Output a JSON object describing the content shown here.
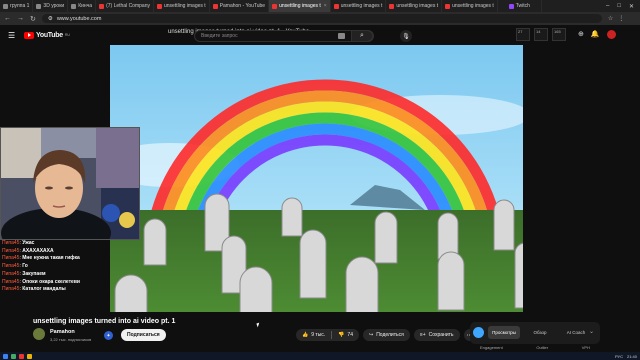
{
  "browser": {
    "tabs": [
      {
        "label": "группа 1",
        "active": false
      },
      {
        "label": "3D уроки",
        "active": false
      },
      {
        "label": "Кинча",
        "active": false
      },
      {
        "label": "(7) Lethal Company",
        "active": false
      },
      {
        "label": "unsettling images t",
        "active": false
      },
      {
        "label": "Pamahon - YouTube",
        "active": false
      },
      {
        "label": "unsettling images t",
        "active": true
      },
      {
        "label": "unsettling images t",
        "active": false
      },
      {
        "label": "unsettling images t",
        "active": false
      },
      {
        "label": "unsettling images t",
        "active": false
      },
      {
        "label": "Twitch",
        "active": false
      }
    ],
    "url": "www.youtube.com"
  },
  "page_title": "unsettling images turned into ai video pt. 1 - YouTube",
  "youtube": {
    "logo_text": "YouTube",
    "logo_region": "RU",
    "search_placeholder": "Введите запрос",
    "stats": [
      "27",
      "14",
      "165"
    ]
  },
  "chat": [
    {
      "user": "Пипа45",
      "msg": "Ужас"
    },
    {
      "user": "Пипа45",
      "msg": "АХАХАХАХА"
    },
    {
      "user": "Пипа45",
      "msg": "Мне нужна такая гифка"
    },
    {
      "user": "Пипа45",
      "msg": "Го"
    },
    {
      "user": "Пипа45",
      "msg": "Закупаем"
    },
    {
      "user": "Пипа45",
      "msg": "Опоки окара скелетеви"
    },
    {
      "user": "Пипа45",
      "msg": "Каталог мандалы"
    }
  ],
  "video": {
    "title": "unsettling images turned into ai video pt. 1",
    "channel": "Pamahon",
    "subscribers": "3,22 тыс. подписчиков",
    "subscribe_label": "Подписаться",
    "likes": "9 тыс.",
    "dislikes": "74",
    "share_label": "Поделиться",
    "save_label": "Сохранить"
  },
  "right_panel": {
    "tabs": [
      "Просмотры",
      "Обзор",
      "AI Coach"
    ],
    "labels": [
      "Engagement",
      "Outlier",
      "VPH"
    ]
  },
  "taskbar": {
    "lang": "РУС",
    "time": "21:40"
  }
}
